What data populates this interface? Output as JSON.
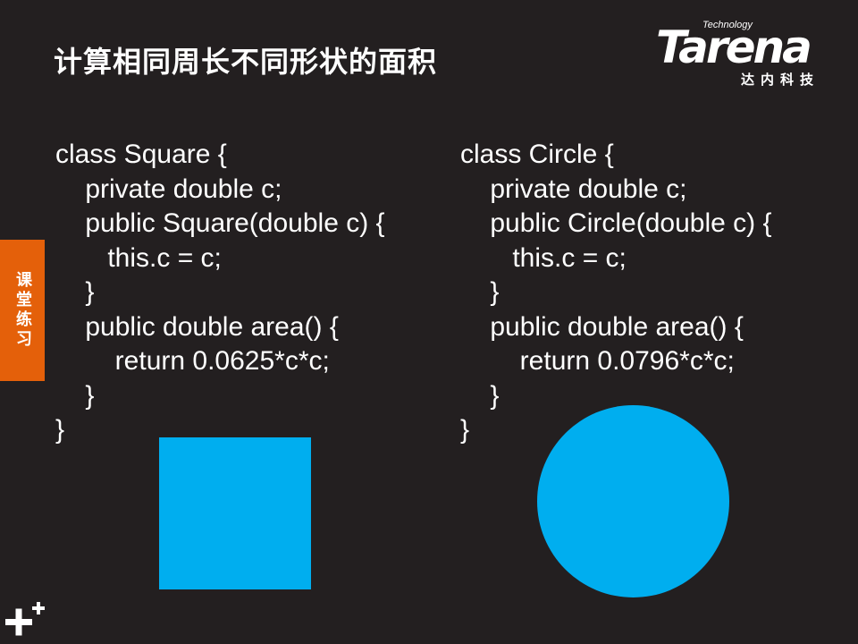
{
  "slide": {
    "title": "计算相同周长不同形状的面积",
    "side_tab": "课堂练习"
  },
  "logo": {
    "wordmark": "Tarena",
    "tagline": "Technology",
    "chinese": "达内科技"
  },
  "code_left": [
    "class Square {",
    "    private double c;",
    "    public Square(double c) {",
    "       this.c = c;",
    "    }",
    "    public double area() {",
    "        return 0.0625*c*c;",
    "    }",
    "}"
  ],
  "code_right": [
    "class Circle {",
    "    private double c;",
    "    public Circle(double c) {",
    "       this.c = c;",
    "    }",
    "    public double area() {",
    "        return 0.0796*c*c;",
    "    }",
    "}"
  ],
  "colors": {
    "background": "#231f20",
    "accent_orange": "#e4600a",
    "shape_blue": "#00aeef",
    "text": "#ffffff"
  },
  "icons": [
    "plus-icon"
  ]
}
